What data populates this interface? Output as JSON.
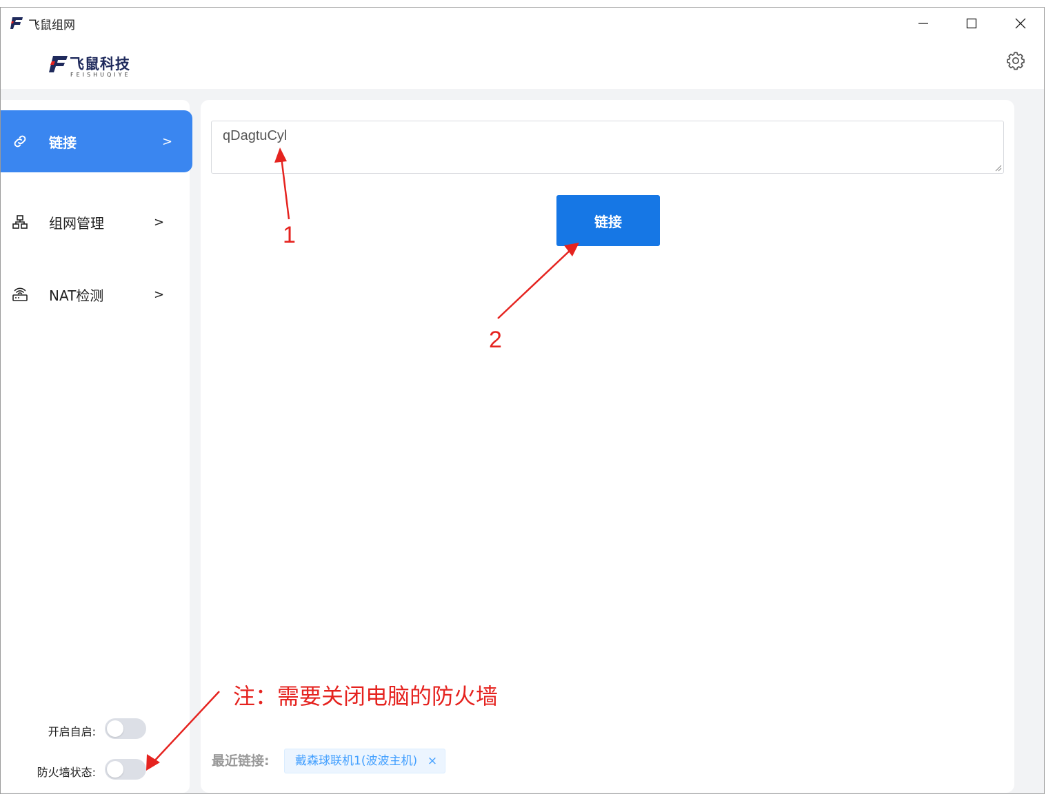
{
  "window": {
    "title": "飞鼠组网",
    "controls": {
      "minimize": "minimize-icon",
      "maximize": "maximize-icon",
      "close": "close-icon"
    }
  },
  "header": {
    "brand_name": "飞鼠科技",
    "brand_sub": "FEISHUQIYE",
    "settings_icon": "gear-icon"
  },
  "sidebar": {
    "items": [
      {
        "label": "链接",
        "arrow": ">",
        "icon": "link-icon",
        "active": true
      },
      {
        "label": "组网管理",
        "arrow": ">",
        "icon": "network-icon",
        "active": false
      },
      {
        "label": "NAT检测",
        "arrow": ">",
        "icon": "router-icon",
        "active": false
      }
    ],
    "toggles": [
      {
        "label": "开启自启:",
        "on": false
      },
      {
        "label": "防火墙状态:",
        "on": false
      }
    ]
  },
  "main": {
    "input_value": "qDagtuCyl",
    "connect_label": "链接",
    "recent_label": "最近链接:",
    "recent_tags": [
      {
        "label": "戴森球联机1(波波主机)",
        "close": "×"
      }
    ]
  },
  "annotations": {
    "marker_1": "1",
    "marker_2": "2",
    "note": "注：需要关闭电脑的防火墙"
  },
  "colors": {
    "accent": "#1677e5",
    "nav_active": "#3a86f0",
    "annotation": "#e5231f",
    "tag_text": "#409eff",
    "brand": "#1f2a5c"
  }
}
